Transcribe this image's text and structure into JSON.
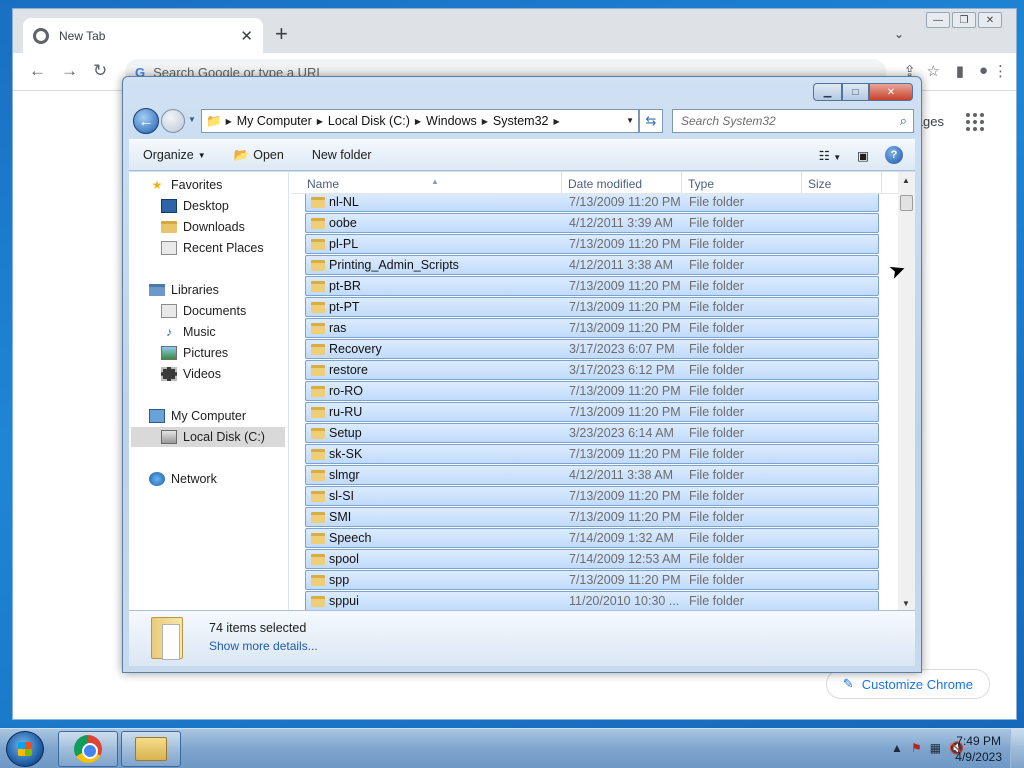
{
  "chrome": {
    "tab_title": "New Tab",
    "new_tab_symbol": "+",
    "omnibox_placeholder": "Search Google or type a URL",
    "images_link": "Images",
    "customize_label": "Customize Chrome"
  },
  "explorer": {
    "breadcrumb": [
      "My Computer",
      "Local Disk (C:)",
      "Windows",
      "System32"
    ],
    "search_placeholder": "Search System32",
    "toolbar": {
      "organize": "Organize",
      "open": "Open",
      "new_folder": "New folder"
    },
    "nav": {
      "favorites": "Favorites",
      "desktop": "Desktop",
      "downloads": "Downloads",
      "recent_places": "Recent Places",
      "libraries": "Libraries",
      "documents": "Documents",
      "music": "Music",
      "pictures": "Pictures",
      "videos": "Videos",
      "my_computer": "My Computer",
      "local_disk": "Local Disk (C:)",
      "network": "Network"
    },
    "columns": {
      "name": "Name",
      "date_modified": "Date modified",
      "type": "Type",
      "size": "Size"
    },
    "rows": [
      {
        "name": "nl-NL",
        "date": "7/13/2009 11:20 PM",
        "type": "File folder"
      },
      {
        "name": "oobe",
        "date": "4/12/2011 3:39 AM",
        "type": "File folder"
      },
      {
        "name": "pl-PL",
        "date": "7/13/2009 11:20 PM",
        "type": "File folder"
      },
      {
        "name": "Printing_Admin_Scripts",
        "date": "4/12/2011 3:38 AM",
        "type": "File folder"
      },
      {
        "name": "pt-BR",
        "date": "7/13/2009 11:20 PM",
        "type": "File folder"
      },
      {
        "name": "pt-PT",
        "date": "7/13/2009 11:20 PM",
        "type": "File folder"
      },
      {
        "name": "ras",
        "date": "7/13/2009 11:20 PM",
        "type": "File folder"
      },
      {
        "name": "Recovery",
        "date": "3/17/2023 6:07 PM",
        "type": "File folder"
      },
      {
        "name": "restore",
        "date": "3/17/2023 6:12 PM",
        "type": "File folder"
      },
      {
        "name": "ro-RO",
        "date": "7/13/2009 11:20 PM",
        "type": "File folder"
      },
      {
        "name": "ru-RU",
        "date": "7/13/2009 11:20 PM",
        "type": "File folder"
      },
      {
        "name": "Setup",
        "date": "3/23/2023 6:14 AM",
        "type": "File folder"
      },
      {
        "name": "sk-SK",
        "date": "7/13/2009 11:20 PM",
        "type": "File folder"
      },
      {
        "name": "slmgr",
        "date": "4/12/2011 3:38 AM",
        "type": "File folder"
      },
      {
        "name": "sl-SI",
        "date": "7/13/2009 11:20 PM",
        "type": "File folder"
      },
      {
        "name": "SMI",
        "date": "7/13/2009 11:20 PM",
        "type": "File folder"
      },
      {
        "name": "Speech",
        "date": "7/14/2009 1:32 AM",
        "type": "File folder"
      },
      {
        "name": "spool",
        "date": "7/14/2009 12:53 AM",
        "type": "File folder"
      },
      {
        "name": "spp",
        "date": "7/13/2009 11:20 PM",
        "type": "File folder"
      },
      {
        "name": "sppui",
        "date": "11/20/2010 10:30 ...",
        "type": "File folder"
      }
    ],
    "details": {
      "selection_count": "74 items selected",
      "show_more": "Show more details..."
    }
  },
  "taskbar": {
    "time": "7:49 PM",
    "date": "4/9/2023"
  },
  "colors": {
    "selection_fill": "#cce1fb",
    "selection_border": "#7da2ce",
    "link_blue": "#1e5bb0",
    "chrome_accent": "#1a73e8"
  }
}
